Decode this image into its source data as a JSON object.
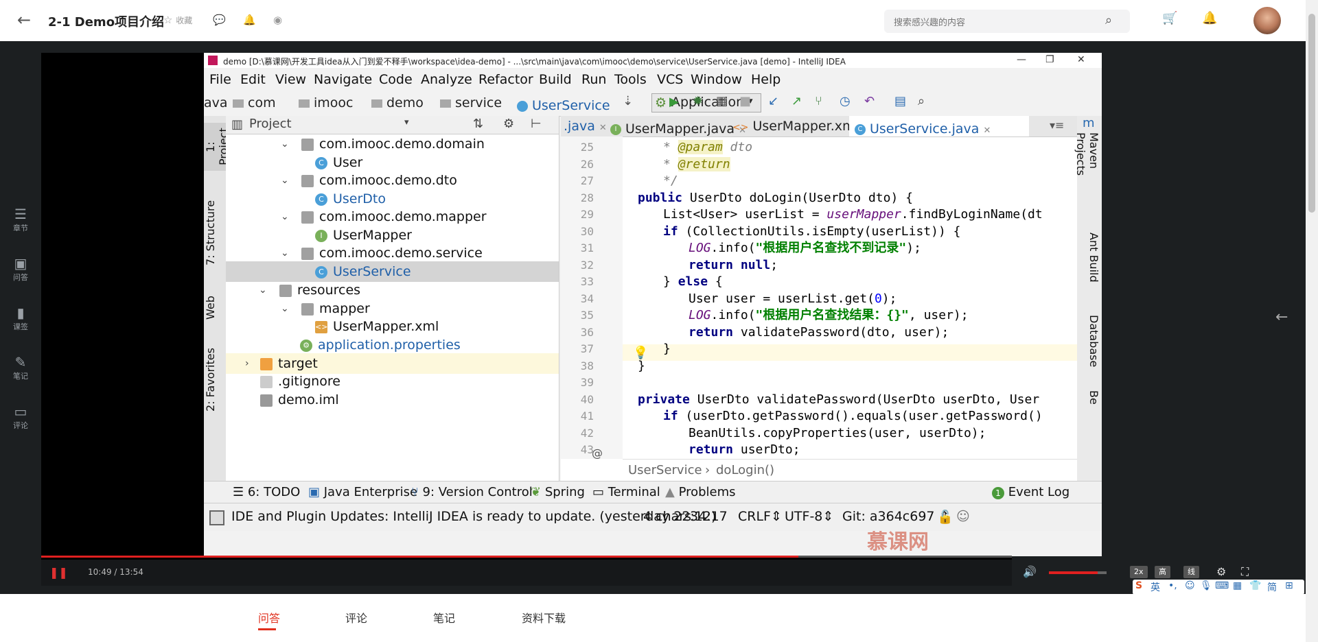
{
  "header": {
    "title": "2-1 Demo项目介绍",
    "favorite_label": "收藏",
    "search_placeholder": "搜索感兴趣的内容"
  },
  "rail": {
    "items": [
      {
        "icon": "chapter-icon",
        "label": "章节"
      },
      {
        "icon": "qa-icon",
        "label": "问答"
      },
      {
        "icon": "courseware-icon",
        "label": "课签"
      },
      {
        "icon": "note-icon",
        "label": "笔记"
      },
      {
        "icon": "comment-icon",
        "label": "评论"
      }
    ]
  },
  "ide": {
    "window_title": "demo [D:\\慕课网\\开发工具idea从入门到爱不释手\\workspace\\idea-demo] - ...\\src\\main\\java\\com\\imooc\\demo\\service\\UserService.java [demo] - IntelliJ IDEA",
    "menu": [
      "File",
      "Edit",
      "View",
      "Navigate",
      "Code",
      "Analyze",
      "Refactor",
      "Build",
      "Run",
      "Tools",
      "VCS",
      "Window",
      "Help"
    ],
    "breadcrumbs": [
      "ava",
      "com",
      "imooc",
      "demo",
      "service",
      "UserService"
    ],
    "run_config": "Application",
    "side_tabs": [
      "1: Project",
      "7: Structure",
      "Web",
      "2: Favorites"
    ],
    "project_panel_title": "Project",
    "tree": [
      {
        "label": "com.imooc.demo.domain",
        "kind": "package",
        "indent": 1
      },
      {
        "label": "User",
        "kind": "class",
        "indent": 2
      },
      {
        "label": "com.imooc.demo.dto",
        "kind": "package",
        "indent": 1
      },
      {
        "label": "UserDto",
        "kind": "class",
        "indent": 2
      },
      {
        "label": "com.imooc.demo.mapper",
        "kind": "package",
        "indent": 1
      },
      {
        "label": "UserMapper",
        "kind": "interface",
        "indent": 2
      },
      {
        "label": "com.imooc.demo.service",
        "kind": "package",
        "indent": 1
      },
      {
        "label": "UserService",
        "kind": "class",
        "indent": 2,
        "selected": true
      },
      {
        "label": "resources",
        "kind": "folder",
        "indent": 0
      },
      {
        "label": "mapper",
        "kind": "folder",
        "indent": 1
      },
      {
        "label": "UserMapper.xml",
        "kind": "xml",
        "indent": 2
      },
      {
        "label": "application.properties",
        "kind": "props",
        "indent": 1
      },
      {
        "label": "target",
        "kind": "folder",
        "indent": -1
      },
      {
        "label": ".gitignore",
        "kind": "file",
        "indent": 0
      },
      {
        "label": "demo.iml",
        "kind": "file",
        "indent": 0
      }
    ],
    "editor_tabs": [
      ".java",
      "UserMapper.java",
      "UserMapper.xml",
      "UserService.java"
    ],
    "line_numbers": [
      "25",
      "26",
      "27",
      "28",
      "29",
      "30",
      "31",
      "32",
      "33",
      "34",
      "35",
      "36",
      "37",
      "38",
      "39",
      "40",
      "41",
      "42",
      "43"
    ],
    "code_lines": [
      "* @param dto",
      "* @return",
      "*/",
      "public UserDto doLogin(UserDto dto) {",
      "List<User> userList = userMapper.findByLoginName(dt",
      "if (CollectionUtils.isEmpty(userList)) {",
      "LOG.info(\"根据用户名查找不到记录\");",
      "return null;",
      "} else {",
      "User user = userList.get(0);",
      "LOG.info(\"根据用户名查找结果：{}\", user);",
      "return validatePassword(dto, user);",
      "}",
      "}",
      "",
      "private UserDto validatePassword(UserDto userDto, User",
      "if (userDto.getPassword().equals(user.getPassword()",
      "BeanUtils.copyProperties(user, userDto);",
      "return userDto;"
    ],
    "editor_breadcrumb": [
      "UserService",
      "doLogin()"
    ],
    "right_tabs": [
      "Maven Projects",
      "Ant Build",
      "Database",
      "Be"
    ],
    "tool_windows": [
      "6: TODO",
      "Java Enterprise",
      "9: Version Control",
      "Spring",
      "Terminal",
      "Problems",
      "Event Log"
    ],
    "event_log_count": "1",
    "status": {
      "message": "IDE and Plugin Updates: IntelliJ IDEA is ready to update. (yesterday 22:12)",
      "chars": "4 chars",
      "position": "34:17",
      "line_sep": "CRLF",
      "encoding": "UTF-8",
      "git": "Git: a364c697"
    },
    "watermark": "慕课网"
  },
  "player": {
    "time": "10:49 / 13:54",
    "progress_fraction": 0.78,
    "volume_fraction": 0.85,
    "speed_label": "2x",
    "quality_label": "高清",
    "line_label": "线路"
  },
  "ime": {
    "lang": "英",
    "simplified": "简"
  },
  "bottom_tabs": [
    "问答",
    "评论",
    "笔记",
    "资料下载"
  ],
  "colors": {
    "accent": "#e0301e",
    "ide_bg": "#f2f2f2",
    "selection": "#d4d4d4"
  }
}
